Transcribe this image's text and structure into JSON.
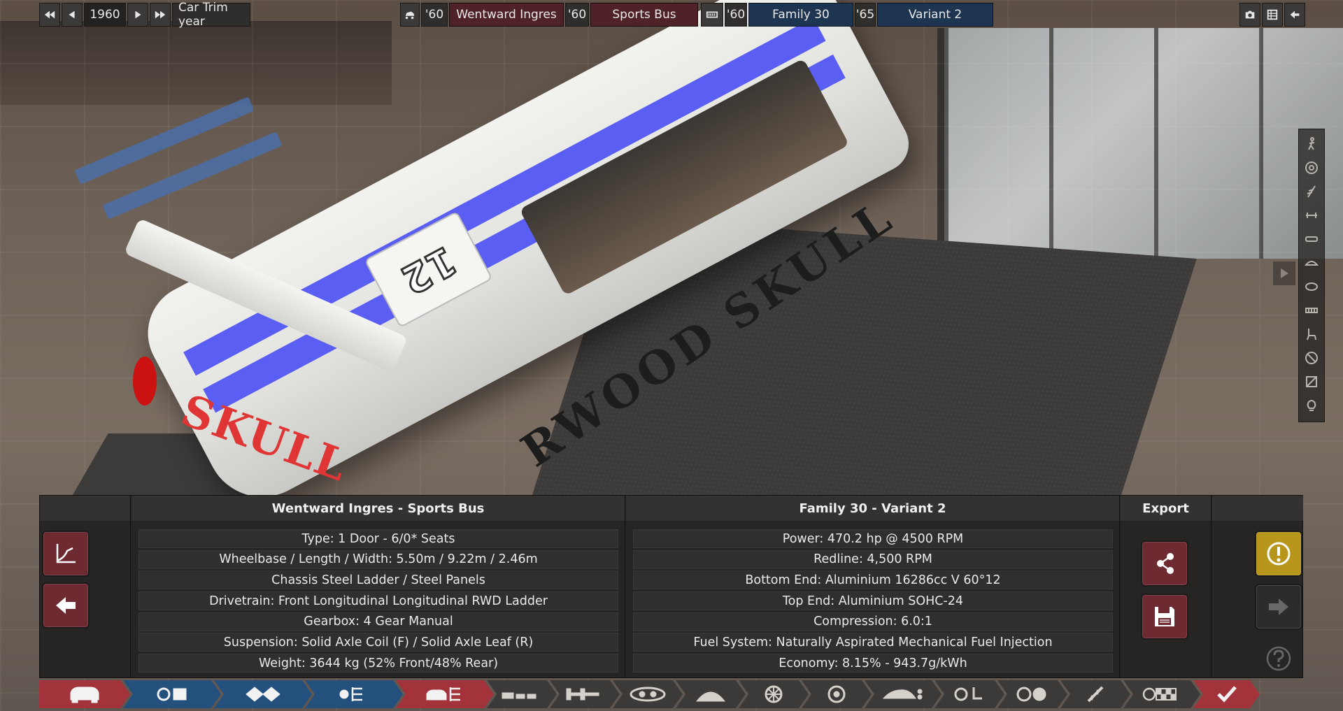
{
  "topbar": {
    "year": "1960",
    "year_label": "Car Trim year",
    "model_year": "'60",
    "model_name": "Wentward Ingres",
    "trim_year": "'60",
    "trim_name": "Sports Bus",
    "family_year": "'60",
    "family_name": "Family 30",
    "variant_year": "'65",
    "variant_name": "Variant 2",
    "icons": [
      "rewind-icon",
      "step-back-icon",
      "play-icon",
      "fast-forward-icon",
      "car-icon",
      "engine-block-icon",
      "camera-icon",
      "spreadsheet-icon",
      "back-arrow-icon"
    ]
  },
  "scene": {
    "livery_text_rear": "SKULL",
    "livery_text_side": "RWOOD SKULL",
    "race_number": "12"
  },
  "side_tools": [
    "pedestrian-icon",
    "wheel-icon",
    "suspension-icon",
    "axle-icon",
    "bumper-icon",
    "hood-icon",
    "headlight-icon",
    "grille-icon",
    "seat-icon",
    "no-entry-icon",
    "panel-icon",
    "light-bulb-icon"
  ],
  "panel": {
    "car_header": "Wentward Ingres - Sports Bus",
    "engine_header": "Family 30 - Variant 2",
    "export_header": "Export",
    "car_rows": [
      "Type: 1 Door - 6/0* Seats",
      "Wheelbase / Length / Width: 5.50m / 9.22m / 2.46m",
      "Chassis Steel Ladder / Steel Panels",
      "Drivetrain: Front Longitudinal Longitudinal RWD Ladder",
      "Gearbox: 4 Gear Manual",
      "Suspension: Solid Axle Coil (F) / Solid Axle Leaf (R)",
      "Weight: 3644 kg (52% Front/48% Rear)"
    ],
    "engine_rows": [
      "Power: 470.2 hp @ 4500 RPM",
      "Redline:  4,500 RPM",
      "Bottom End: Aluminium 16286cc V 60°12",
      "Top End: Aluminium SOHC-24",
      "Compression: 6.0:1",
      "Fuel System: Naturally Aspirated Mechanical Fuel Injection",
      "Economy: 8.15% - 943.7g/kWh"
    ]
  },
  "bottom_nav": [
    "car-body-icon",
    "model-files-icon",
    "trim-files-icon",
    "engine-tree-icon",
    "car-trim-tree-icon",
    "body-fixtures-icon",
    "chassis-icon",
    "engine-icon",
    "gearbox-icon",
    "wheels-icon",
    "brakes-icon",
    "aero-icon",
    "interior-icon",
    "safety-icon",
    "tuning-icon",
    "testing-icon",
    "finish-checkmark-icon"
  ]
}
